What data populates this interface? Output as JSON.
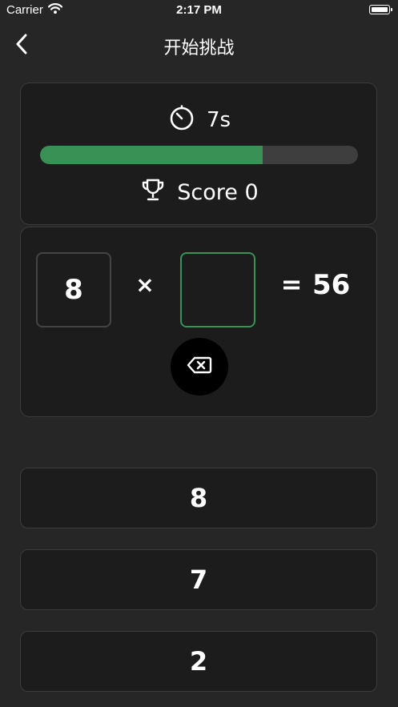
{
  "status_bar": {
    "carrier": "Carrier",
    "time": "2:17 PM"
  },
  "nav": {
    "title": "开始挑战"
  },
  "timer": {
    "label": "7s",
    "progress": 0.7
  },
  "score": {
    "label": "Score 0"
  },
  "equation": {
    "left_operand": "8",
    "operator": "×",
    "answer_input": "",
    "equals": "=",
    "result": "56"
  },
  "options": [
    "8",
    "7",
    "2"
  ],
  "colors": {
    "background": "#262626",
    "card": "#1c1c1c",
    "accent_green": "#3a9156",
    "track": "#3e3e3e"
  },
  "icons": {
    "back": "chevron-left-icon",
    "timer": "timer-icon",
    "trophy": "trophy-icon",
    "delete": "delete-backspace-icon"
  }
}
